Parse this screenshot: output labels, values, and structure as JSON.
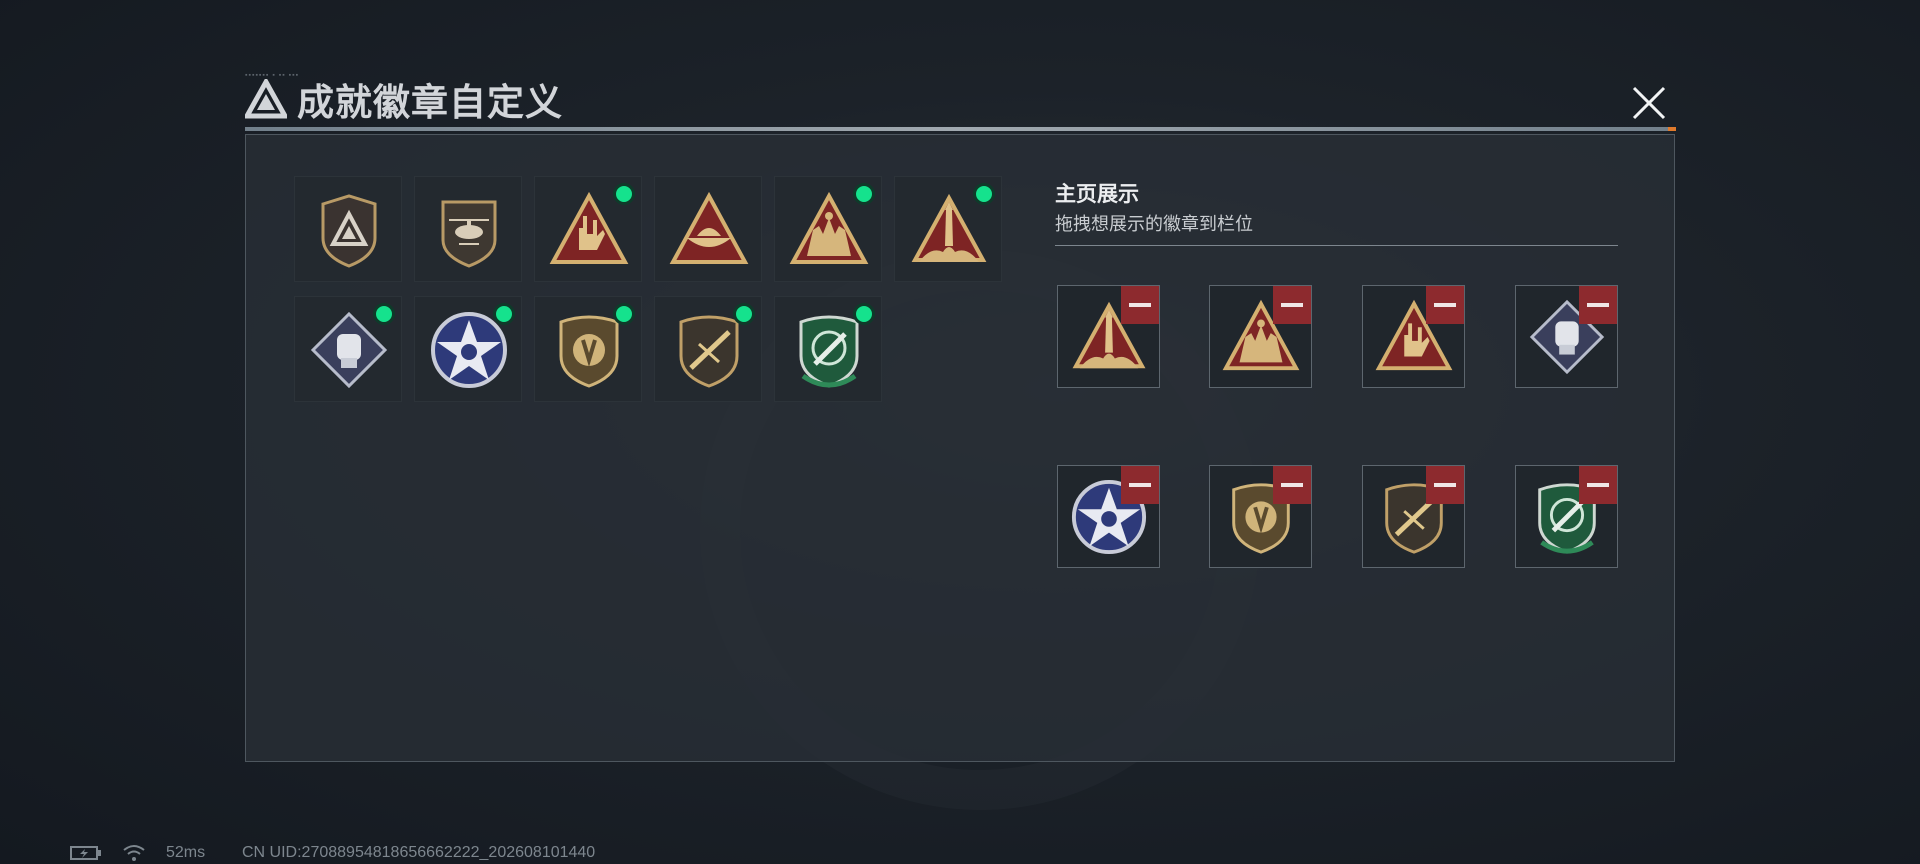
{
  "window": {
    "title": "成就徽章自定义"
  },
  "badges": [
    {
      "name": "shield-badge",
      "active": false
    },
    {
      "name": "helicopter-badge",
      "active": false
    },
    {
      "name": "hand-sign-badge",
      "active": true
    },
    {
      "name": "boat-badge",
      "active": false
    },
    {
      "name": "soldiers-badge",
      "active": true
    },
    {
      "name": "rocket-badge",
      "active": true
    },
    {
      "name": "fist-badge",
      "active": true
    },
    {
      "name": "star-eagle-badge",
      "active": true
    },
    {
      "name": "emblem-badge",
      "active": true
    },
    {
      "name": "rifle-badge",
      "active": true
    },
    {
      "name": "green-shield-badge",
      "active": true
    }
  ],
  "showcase": {
    "title": "主页展示",
    "subtitle": "拖拽想展示的徽章到栏位",
    "slots": [
      "rocket-badge",
      "soldiers-badge",
      "hand-sign-badge",
      "fist-badge",
      "star-eagle-badge",
      "emblem-badge",
      "rifle-badge",
      "green-shield-badge"
    ]
  },
  "status": {
    "ping": "52ms",
    "uid": "CN UID:27088954818656662222_202608101440"
  },
  "colors": {
    "accent_green": "#15e28d",
    "remove_red": "#8d2a2e",
    "gold": "#c8a45c"
  }
}
